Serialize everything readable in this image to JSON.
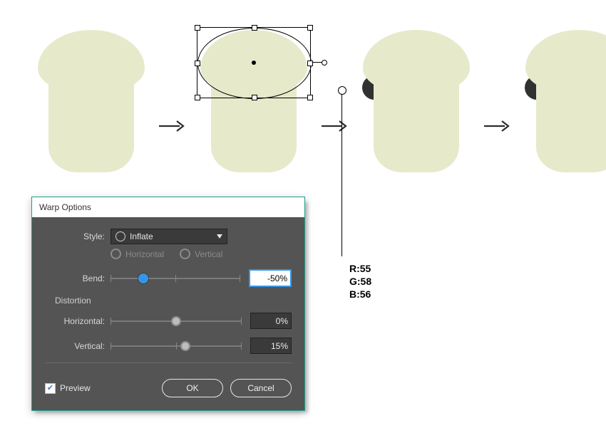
{
  "rgb": {
    "r_label": "R:55",
    "g_label": "G:58",
    "b_label": "B:56"
  },
  "dialog": {
    "title": "Warp Options",
    "style_label": "Style:",
    "style_value": "Inflate",
    "horizontal_radio": "Horizontal",
    "vertical_radio": "Vertical",
    "bend_label": "Bend:",
    "bend_value": "-50%",
    "distortion_section": "Distortion",
    "dist_h_label": "Horizontal:",
    "dist_h_value": "0%",
    "dist_v_label": "Vertical:",
    "dist_v_value": "15%",
    "preview_label": "Preview",
    "ok": "OK",
    "cancel": "Cancel"
  },
  "sliders": {
    "bend_pct": 25,
    "h_pct": 50,
    "v_pct": 57
  }
}
